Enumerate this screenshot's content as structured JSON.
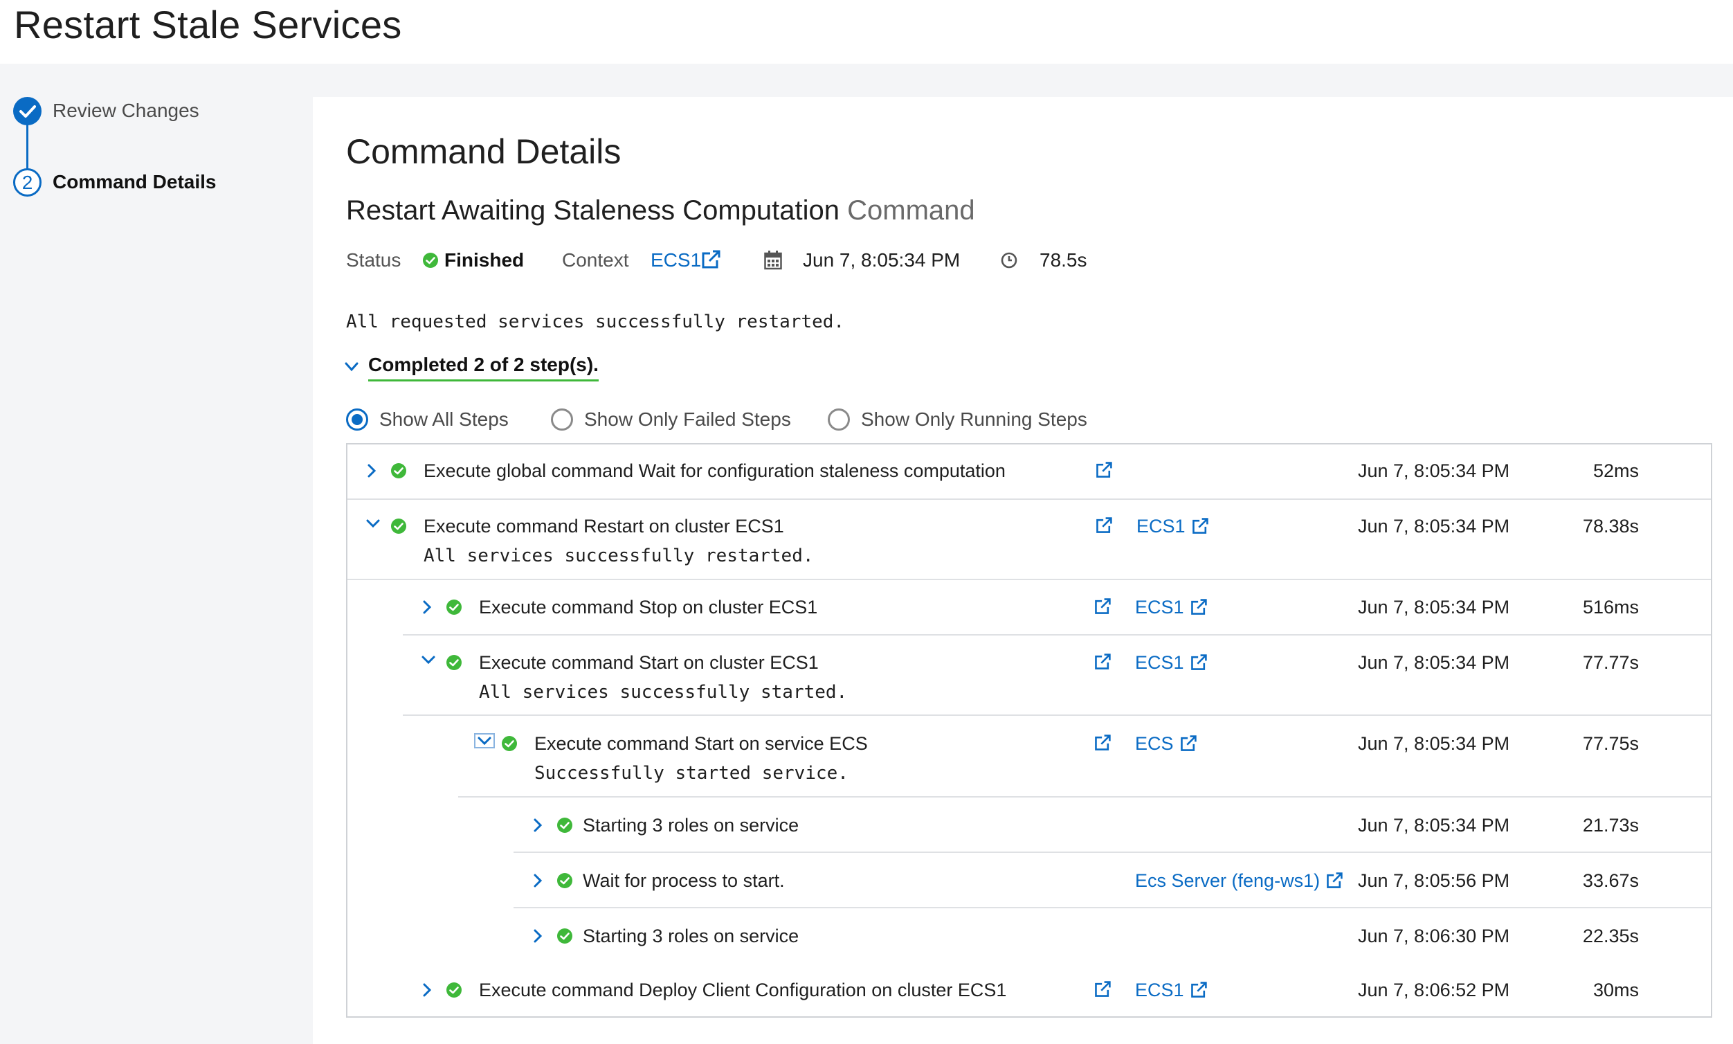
{
  "page": {
    "title": "Restart Stale Services"
  },
  "wizard": {
    "steps": [
      {
        "number": "1",
        "label": "Review Changes",
        "state": "done"
      },
      {
        "number": "2",
        "label": "Command Details",
        "state": "current"
      }
    ]
  },
  "details": {
    "heading": "Command Details",
    "command_name": "Restart Awaiting Staleness Computation",
    "command_suffix": "Command",
    "status_label": "Status",
    "status_value": "Finished",
    "context_label": "Context",
    "context_value": "ECS1",
    "date": "Jun 7, 8:05:34 PM",
    "duration": "78.5s",
    "result_message": "All requested services successfully restarted.",
    "completed_label": "Completed 2 of 2 step(s)."
  },
  "filters": [
    {
      "label": "Show All Steps",
      "checked": true
    },
    {
      "label": "Show Only Failed Steps",
      "checked": false
    },
    {
      "label": "Show Only Running Steps",
      "checked": false
    }
  ],
  "steps": [
    {
      "title": "Execute global command Wait for configuration staleness computation",
      "context": "",
      "date": "Jun 7, 8:05:34 PM",
      "duration": "52ms",
      "expanded": false
    },
    {
      "title": "Execute command Restart on cluster ECS1",
      "message": "All services successfully restarted.",
      "context": "ECS1",
      "date": "Jun 7, 8:05:34 PM",
      "duration": "78.38s",
      "expanded": true
    },
    {
      "title": "Execute command Stop on cluster ECS1",
      "context": "ECS1",
      "date": "Jun 7, 8:05:34 PM",
      "duration": "516ms",
      "expanded": false
    },
    {
      "title": "Execute command Start on cluster ECS1",
      "message": "All services successfully started.",
      "context": "ECS1",
      "date": "Jun 7, 8:05:34 PM",
      "duration": "77.77s",
      "expanded": true
    },
    {
      "title": "Execute command Start on service ECS",
      "message": "Successfully started service.",
      "context": "ECS",
      "date": "Jun 7, 8:05:34 PM",
      "duration": "77.75s",
      "expanded": true
    },
    {
      "title": "Starting 3 roles on service",
      "context": "",
      "date": "Jun 7, 8:05:34 PM",
      "duration": "21.73s",
      "expanded": false
    },
    {
      "title": "Wait for process to start.",
      "context": "Ecs Server (feng-ws1)",
      "date": "Jun 7, 8:05:56 PM",
      "duration": "33.67s",
      "expanded": false
    },
    {
      "title": "Starting 3 roles on service",
      "context": "",
      "date": "Jun 7, 8:06:30 PM",
      "duration": "22.35s",
      "expanded": false
    },
    {
      "title": "Execute command Deploy Client Configuration on cluster ECS1",
      "context": "ECS1",
      "date": "Jun 7, 8:06:52 PM",
      "duration": "30ms",
      "expanded": false
    }
  ],
  "icons": {
    "success": "check-circle-icon",
    "external": "external-link-icon",
    "calendar": "calendar-icon",
    "clock": "clock-icon",
    "expand": "chevron-right-icon",
    "collapse": "chevron-down-icon"
  },
  "colors": {
    "accent": "#0a6bc4",
    "success": "#3fb83a",
    "background": "#f4f5f7"
  }
}
